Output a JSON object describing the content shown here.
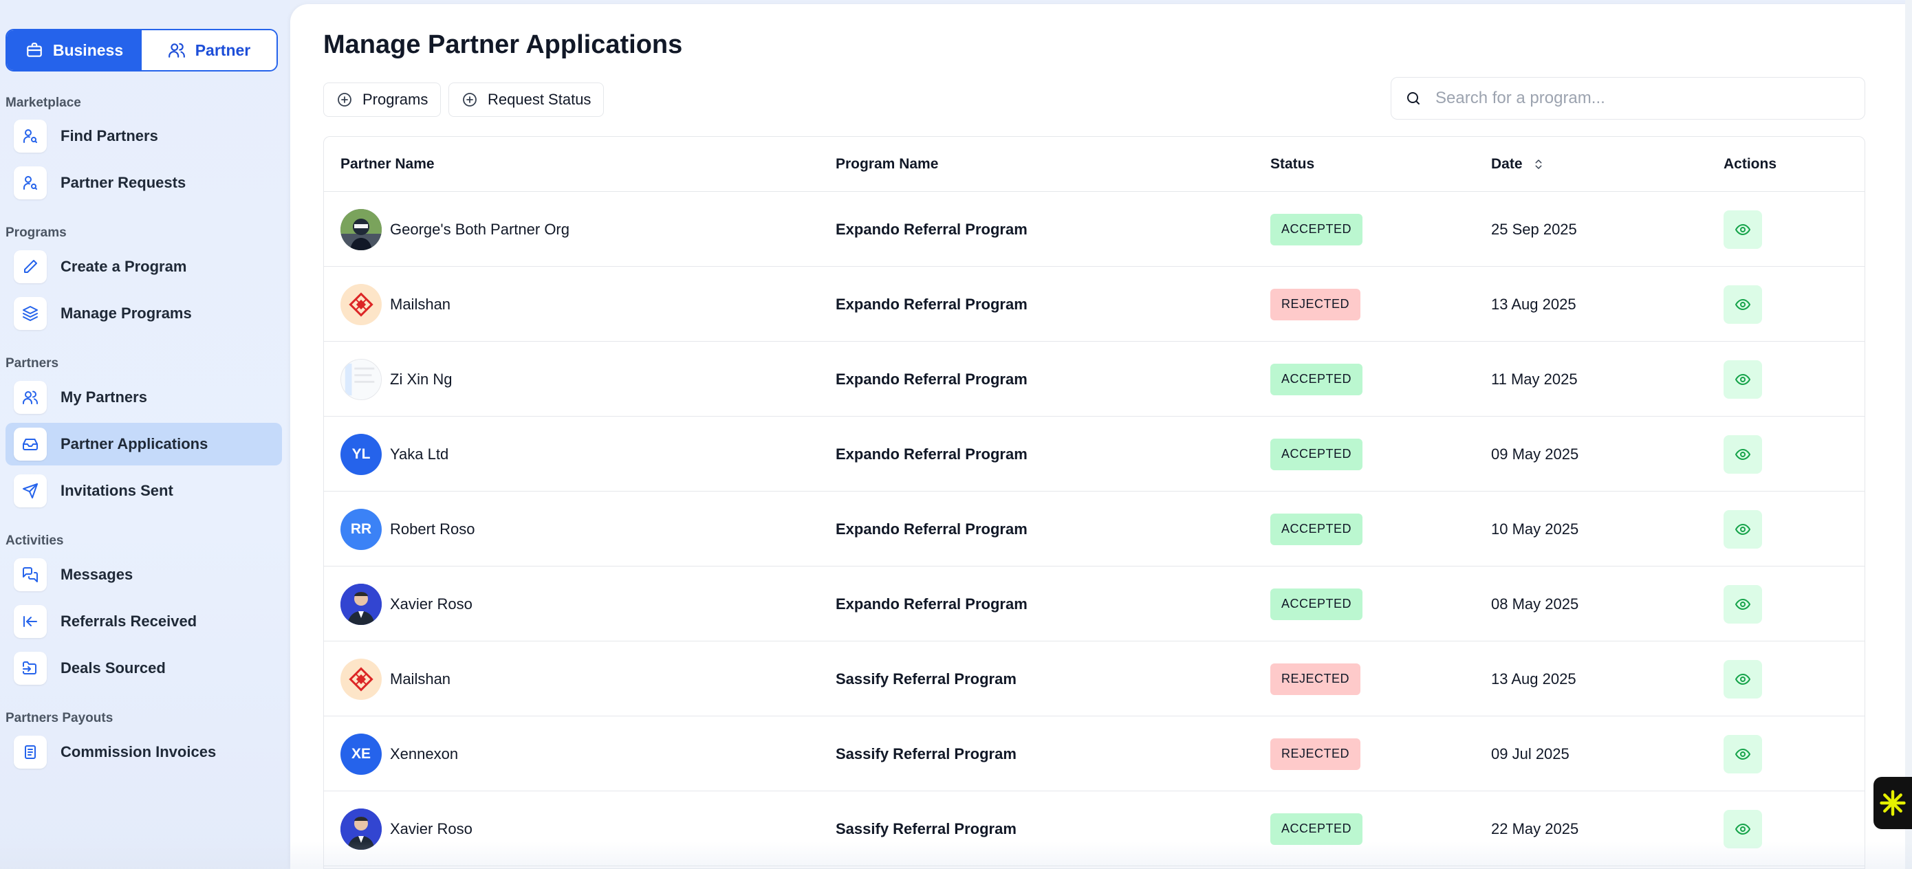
{
  "toggle": {
    "business_label": "Business",
    "partner_label": "Partner"
  },
  "sidebar": {
    "sections": {
      "marketplace": "Marketplace",
      "programs": "Programs",
      "partners": "Partners",
      "activities": "Activities",
      "payouts": "Partners Payouts"
    },
    "items": [
      {
        "label": "Find Partners",
        "icon": "user-search-icon"
      },
      {
        "label": "Partner Requests",
        "icon": "user-search-icon"
      },
      {
        "label": "Create a Program",
        "icon": "pencil-icon"
      },
      {
        "label": "Manage Programs",
        "icon": "layers-icon"
      },
      {
        "label": "My Partners",
        "icon": "users-icon"
      },
      {
        "label": "Partner Applications",
        "icon": "inbox-icon",
        "active": true
      },
      {
        "label": "Invitations Sent",
        "icon": "send-icon"
      },
      {
        "label": "Messages",
        "icon": "messages-icon"
      },
      {
        "label": "Referrals Received",
        "icon": "arrow-left-to-line-icon"
      },
      {
        "label": "Deals Sourced",
        "icon": "folder-input-icon"
      },
      {
        "label": "Commission Invoices",
        "icon": "document-icon"
      }
    ]
  },
  "main": {
    "title": "Manage Partner Applications",
    "filters": {
      "programs": "Programs",
      "request_status": "Request Status"
    },
    "search_placeholder": "Search for a program..."
  },
  "table": {
    "headers": {
      "partner": "Partner Name",
      "program": "Program Name",
      "status": "Status",
      "date": "Date",
      "actions": "Actions"
    },
    "rows": [
      {
        "partner": "George's Both Partner Org",
        "program": "Expando Referral Program",
        "status": "ACCEPTED",
        "date": "25 Sep 2025",
        "avatar": "photo"
      },
      {
        "partner": "Mailshan",
        "program": "Expando Referral Program",
        "status": "REJECTED",
        "date": "13 Aug 2025",
        "avatar": "logo"
      },
      {
        "partner": "Zi Xin Ng",
        "program": "Expando Referral Program",
        "status": "ACCEPTED",
        "date": "11 May 2025",
        "avatar": "screenshot"
      },
      {
        "partner": "Yaka Ltd",
        "program": "Expando Referral Program",
        "status": "ACCEPTED",
        "date": "09 May 2025",
        "avatar": "initials",
        "initials": "YL"
      },
      {
        "partner": "Robert Roso",
        "program": "Expando Referral Program",
        "status": "ACCEPTED",
        "date": "10 May 2025",
        "avatar": "initials",
        "initials": "RR"
      },
      {
        "partner": "Xavier Roso",
        "program": "Expando Referral Program",
        "status": "ACCEPTED",
        "date": "08 May 2025",
        "avatar": "person"
      },
      {
        "partner": "Mailshan",
        "program": "Sassify Referral Program",
        "status": "REJECTED",
        "date": "13 Aug 2025",
        "avatar": "logo"
      },
      {
        "partner": "Xennexon",
        "program": "Sassify Referral Program",
        "status": "REJECTED",
        "date": "09 Jul 2025",
        "avatar": "initials",
        "initials": "XE"
      },
      {
        "partner": "Xavier Roso",
        "program": "Sassify Referral Program",
        "status": "ACCEPTED",
        "date": "22 May 2025",
        "avatar": "person"
      }
    ]
  },
  "colors": {
    "accent": "#2563eb",
    "accepted_bg": "#bbf7d0",
    "rejected_bg": "#fecaca",
    "active_nav_bg": "#c5dafa",
    "eye_bg": "#dcfce7",
    "eye_icon": "#16a34a"
  }
}
